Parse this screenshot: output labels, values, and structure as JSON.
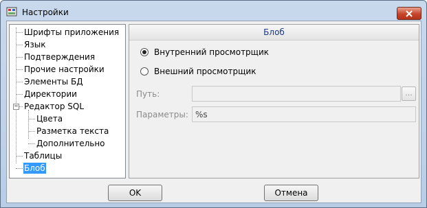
{
  "window": {
    "title": "Настройки"
  },
  "tree": {
    "items": [
      {
        "label": "Шрифты приложения"
      },
      {
        "label": "Язык"
      },
      {
        "label": "Подтверждения"
      },
      {
        "label": "Прочие настройки"
      },
      {
        "label": "Элементы БД"
      },
      {
        "label": "Директории"
      },
      {
        "label": "Редактор SQL",
        "expanded": true
      },
      {
        "label": "Цвета"
      },
      {
        "label": "Разметка текста"
      },
      {
        "label": "Дополнительно"
      },
      {
        "label": "Таблицы"
      },
      {
        "label": "Блоб",
        "selected": true
      }
    ]
  },
  "panel": {
    "header": "Блоб",
    "radio_internal": {
      "label": "Внутренний просмотрщик",
      "checked": true
    },
    "radio_external": {
      "label": "Внешний просмотрщик",
      "checked": false
    },
    "path": {
      "label": "Путь:",
      "value": ""
    },
    "browse_label": "...",
    "params": {
      "label": "Параметры:",
      "value": "%s"
    }
  },
  "buttons": {
    "ok": "OK",
    "cancel": "Отмена"
  }
}
